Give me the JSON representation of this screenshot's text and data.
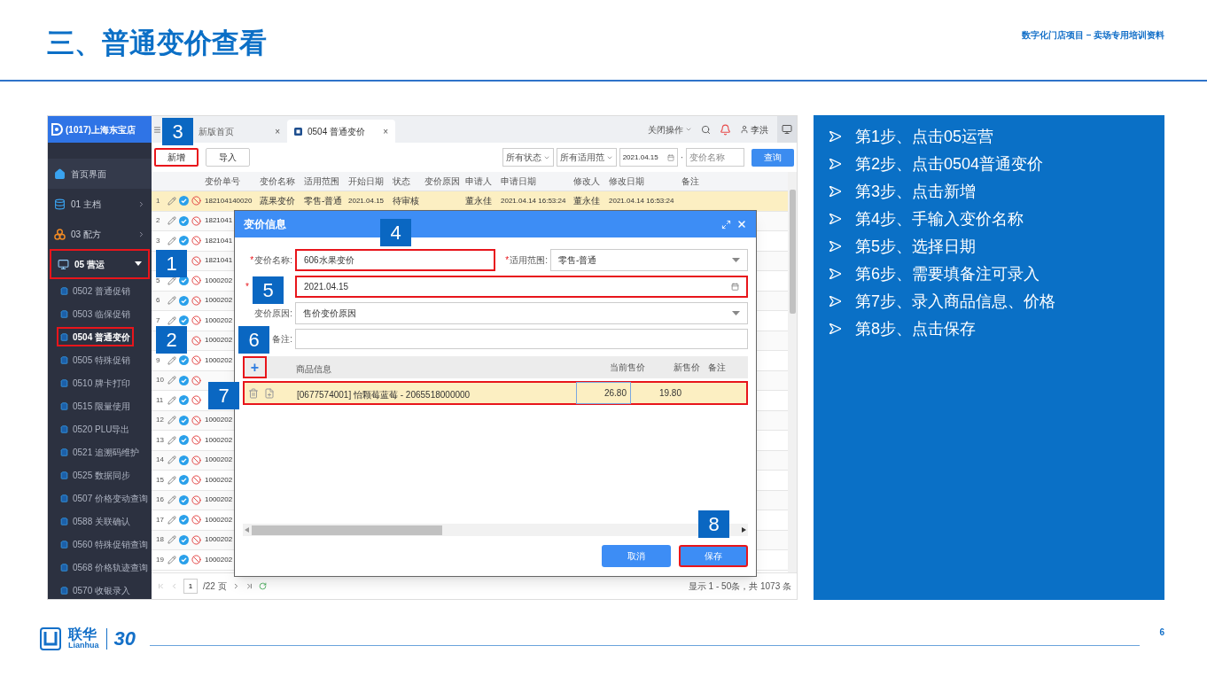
{
  "slide": {
    "title": "三、普通变价查看",
    "subtitle": "数字化门店项目 – 卖场专用培训资料",
    "page_number": "6"
  },
  "logo": {
    "name": "联华",
    "latin": "Lianhua",
    "anniversary": "30"
  },
  "app": {
    "store": "(1017)上海东宝店",
    "nav": [
      {
        "label": "首页界面",
        "kind": "home"
      },
      {
        "label": "01 主档",
        "kind": "database",
        "expanded": false
      },
      {
        "label": "03 配方",
        "kind": "recipe",
        "expanded": false
      },
      {
        "label": "05 营运",
        "kind": "monitor",
        "expanded": true,
        "highlighted": true,
        "children": [
          {
            "label": "0502 普通促销",
            "selected": false,
            "highlighted": false
          },
          {
            "label": "0503 临保促销",
            "selected": false,
            "highlighted": false
          },
          {
            "label": "0504 普通变价",
            "selected": true,
            "highlighted": true
          },
          {
            "label": "0505 特殊促销",
            "selected": false,
            "highlighted": false
          },
          {
            "label": "0510 牌卡打印",
            "selected": false,
            "highlighted": false
          },
          {
            "label": "0515 限量使用",
            "selected": false,
            "highlighted": false
          },
          {
            "label": "0520 PLU导出",
            "selected": false,
            "highlighted": false
          },
          {
            "label": "0521 追溯码维护",
            "selected": false,
            "highlighted": false
          },
          {
            "label": "0525 数据同步",
            "selected": false,
            "highlighted": false
          },
          {
            "label": "0507 价格变动查询",
            "selected": false,
            "highlighted": false
          },
          {
            "label": "0588 关联确认",
            "selected": false,
            "highlighted": false
          },
          {
            "label": "0560 特殊促销查询",
            "selected": false,
            "highlighted": false
          },
          {
            "label": "0568 价格轨迹查询",
            "selected": false,
            "highlighted": false
          },
          {
            "label": "0570 收银录入",
            "selected": false,
            "highlighted": false
          }
        ]
      }
    ],
    "tabs": [
      {
        "label": "新版首页",
        "selected": false,
        "close": "×"
      },
      {
        "label": "0504 普通变价",
        "selected": true,
        "close": "×"
      }
    ],
    "header": {
      "close_ops": "关闭操作",
      "user": "李洪"
    },
    "toolbar": {
      "buttons": [
        {
          "label": "新增",
          "highlighted": true
        },
        {
          "label": "导入",
          "highlighted": false
        }
      ],
      "status_filter": "所有状态",
      "scope_filter": "所有适用范",
      "date": "2021.04.15",
      "separator": "·",
      "name_placeholder": "变价名称",
      "search": "查询"
    },
    "table": {
      "columns": [
        "变价单号",
        "变价名称",
        "适用范围",
        "开始日期",
        "状态",
        "变价原因",
        "申请人",
        "申请日期",
        "修改人",
        "修改日期",
        "备注"
      ],
      "rows": [
        {
          "index": "1",
          "selected": true,
          "cells": [
            "182104140020",
            "蔬果变价",
            "零售-普通",
            "2021.04.15",
            "待审核",
            null,
            "董永佳",
            "2021.04.14 16:53:24",
            "董永佳",
            "2021.04.14 16:53:24",
            null
          ]
        },
        {
          "index": "2",
          "selected": false,
          "cells": [
            "1821041"
          ]
        },
        {
          "index": "3",
          "selected": false,
          "cells": [
            "1821041"
          ]
        },
        {
          "selected": false,
          "cells": [
            "1821041"
          ]
        },
        {
          "index": "5",
          "selected": false,
          "cells": [
            "1000202"
          ]
        },
        {
          "index": "6",
          "selected": false,
          "cells": [
            "1000202"
          ]
        },
        {
          "index": "7",
          "selected": false,
          "cells": [
            "1000202"
          ]
        },
        {
          "selected": false,
          "cells": [
            "1000202"
          ]
        },
        {
          "index": "9",
          "selected": false,
          "cells": [
            "1000202"
          ]
        },
        {
          "index": "10",
          "selected": false
        },
        {
          "index": "11",
          "selected": false
        },
        {
          "index": "12",
          "selected": false,
          "cells": [
            "1000202"
          ]
        },
        {
          "index": "13",
          "selected": false,
          "cells": [
            "1000202"
          ]
        },
        {
          "index": "14",
          "selected": false,
          "cells": [
            "1000202"
          ]
        },
        {
          "index": "15",
          "selected": false,
          "cells": [
            "1000202"
          ]
        },
        {
          "index": "16",
          "selected": false,
          "cells": [
            "1000202"
          ]
        },
        {
          "index": "17",
          "selected": false,
          "cells": [
            "1000202"
          ]
        },
        {
          "index": "18",
          "selected": false,
          "cells": [
            "1000202"
          ]
        },
        {
          "index": "19",
          "selected": false,
          "cells": [
            "1000202"
          ]
        }
      ]
    },
    "pager": {
      "page": "1",
      "total_pages": "/22 页",
      "summary": "显示 1 - 50条，共 1073 条"
    },
    "dialog": {
      "title": "变价信息",
      "name_field": {
        "mark": "*",
        "label": "变价名称:",
        "value": "606水果变价",
        "highlighted": true
      },
      "scope_field": {
        "mark": "*",
        "label": "适用范围:",
        "value": "零售-普通"
      },
      "date_field": {
        "mark": "*",
        "value": "2021.04.15",
        "highlighted": true
      },
      "reason_field": {
        "label": "变价原因:",
        "value": "售价变价原因"
      },
      "note_field": {
        "label": "备注:"
      },
      "grid": {
        "add": {
          "label": "+",
          "highlighted": true
        },
        "columns": [
          "商品信息",
          "当前售价",
          "新售价",
          "备注"
        ],
        "rows": [
          {
            "product": "[0677574001] 怡颗莓蓝莓 - 2065518000000",
            "current_price": "26.80",
            "new_price": "19.80",
            "highlighted": true
          }
        ]
      },
      "buttons": [
        {
          "label": "取消",
          "highlighted": false
        },
        {
          "label": "保存",
          "highlighted": true
        }
      ]
    },
    "markers": [
      "3",
      "1",
      "2",
      "4",
      "5",
      "6",
      "7",
      "8"
    ]
  },
  "steps": [
    "第1步、点击05运营",
    "第2步、点击0504普通变价",
    "第3步、点击新增",
    "第4步、手输入变价名称",
    "第5步、选择日期",
    "第6步、需要填备注可录入",
    "第7步、录入商品信息、价格",
    "第8步、点击保存"
  ]
}
